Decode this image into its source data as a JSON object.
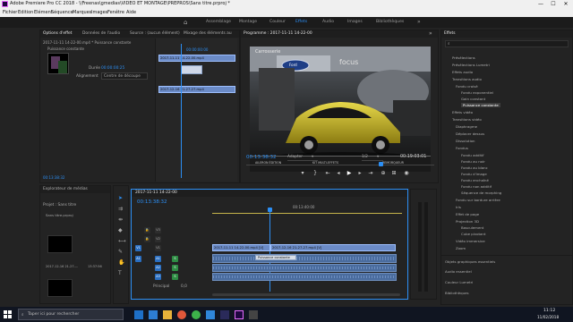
{
  "window": {
    "title": "Adobe Premiere Pro CC 2018 - \\\\Freenas\\gmedias\\VIDEO ET MONTAGE\\PREPROS\\Sans titre.prproj *",
    "minimize": "—",
    "maximize": "☐",
    "close": "✕"
  },
  "menu": [
    "Fichier",
    "Edition",
    "Elément",
    "Séquence",
    "Marques",
    "Images",
    "Fenêtre",
    "Aide"
  ],
  "workspaces": [
    "Assemblage",
    "Montage",
    "Couleur",
    "Effets",
    "Audio",
    "Images",
    "Bibliothèques"
  ],
  "active_workspace": "Effets",
  "source_panel": {
    "tabs": [
      "Options d'effet",
      "Données de l'audio",
      "Source : (aucun élément)",
      "Mixage des éléments au"
    ],
    "clip_name": "2017-11-11 14-22-00.mp4 * Puissance constante",
    "effect_name": "Puissance constante",
    "timecode": "00:00:00:00",
    "duration_label": "Durée",
    "duration_value": "00:00:00:25",
    "align_label": "Alignement",
    "align_value": "Centre de découpe",
    "clip_a": "2017-11-11 14-22-00.mp4",
    "clip_b": "2017-12-16 21-27-27.mp4",
    "bottom_timecode": "00:13:38:32"
  },
  "program_panel": {
    "tab": "Programme : 2017-11-11 14-22-00",
    "game_header": "Carrosserie",
    "game_brand": "Ford",
    "game_model": "focus",
    "game_menu": [
      "AILERON ÉDITION",
      "KIT MULTI-EFFETS",
      "REMORQUEUR"
    ],
    "timecode_current": "00:13:38:32",
    "fit": "Adapter",
    "resolution": "1/2",
    "timecode_total": "00:19:03:01"
  },
  "project_panel": {
    "tabs": [
      "Explorateur de médias",
      "Projet : Sans titre"
    ],
    "project_name": "Sans titre.prproj",
    "item_name": "2017-12-16 21-27-...",
    "item_duration": "13:37:56"
  },
  "timeline": {
    "tab": "2017-11-11 14-22-00",
    "timecode": "00:13:38:32",
    "ruler_label": "00:13:40:00",
    "tracks_video": [
      "V3",
      "V2",
      "V1"
    ],
    "tracks_audio": [
      "A1",
      "A2",
      "A3"
    ],
    "master_label": "Principal",
    "master_value": "0,0",
    "video_clip_a": "2017-11-11 14-22-00.mp4 [V]",
    "video_clip_b": "2017-12-16 21-27-27.mp4 [V]",
    "transition_label": "Puissance constante"
  },
  "effects_panel": {
    "tab": "Effets",
    "items": [
      "Présélections",
      "Présélections Lumetri",
      "Effets audio",
      "Transitions audio",
      "Fondu croisé",
      "Fondu exponentiel",
      "Gain constant",
      "Puissance constante",
      "Effets vidéo",
      "Transitions vidéo",
      "Diaphragme",
      "Déplacer dessus",
      "Dissolution",
      "Fondus",
      "Fondu additif",
      "Fondu au noir",
      "Fondu au blanc",
      "Fondu d'image",
      "Fondu enchaîné",
      "Fondu non additif",
      "Séquence de morphing",
      "Fondu sur bordure arrière",
      "Iris",
      "Effet de page",
      "Projection 3D",
      "Basculement",
      "Cube pivotant",
      "Vidéo immersive",
      "Zoom"
    ],
    "bottom_panels": [
      "Objets graphiques essentiels",
      "Audio essentiel",
      "Couleur Lumetri",
      "Bibliothèques"
    ]
  },
  "taskbar": {
    "search_placeholder": "Taper ici pour rechercher",
    "time": "11:12",
    "date": "11/02/2018"
  }
}
